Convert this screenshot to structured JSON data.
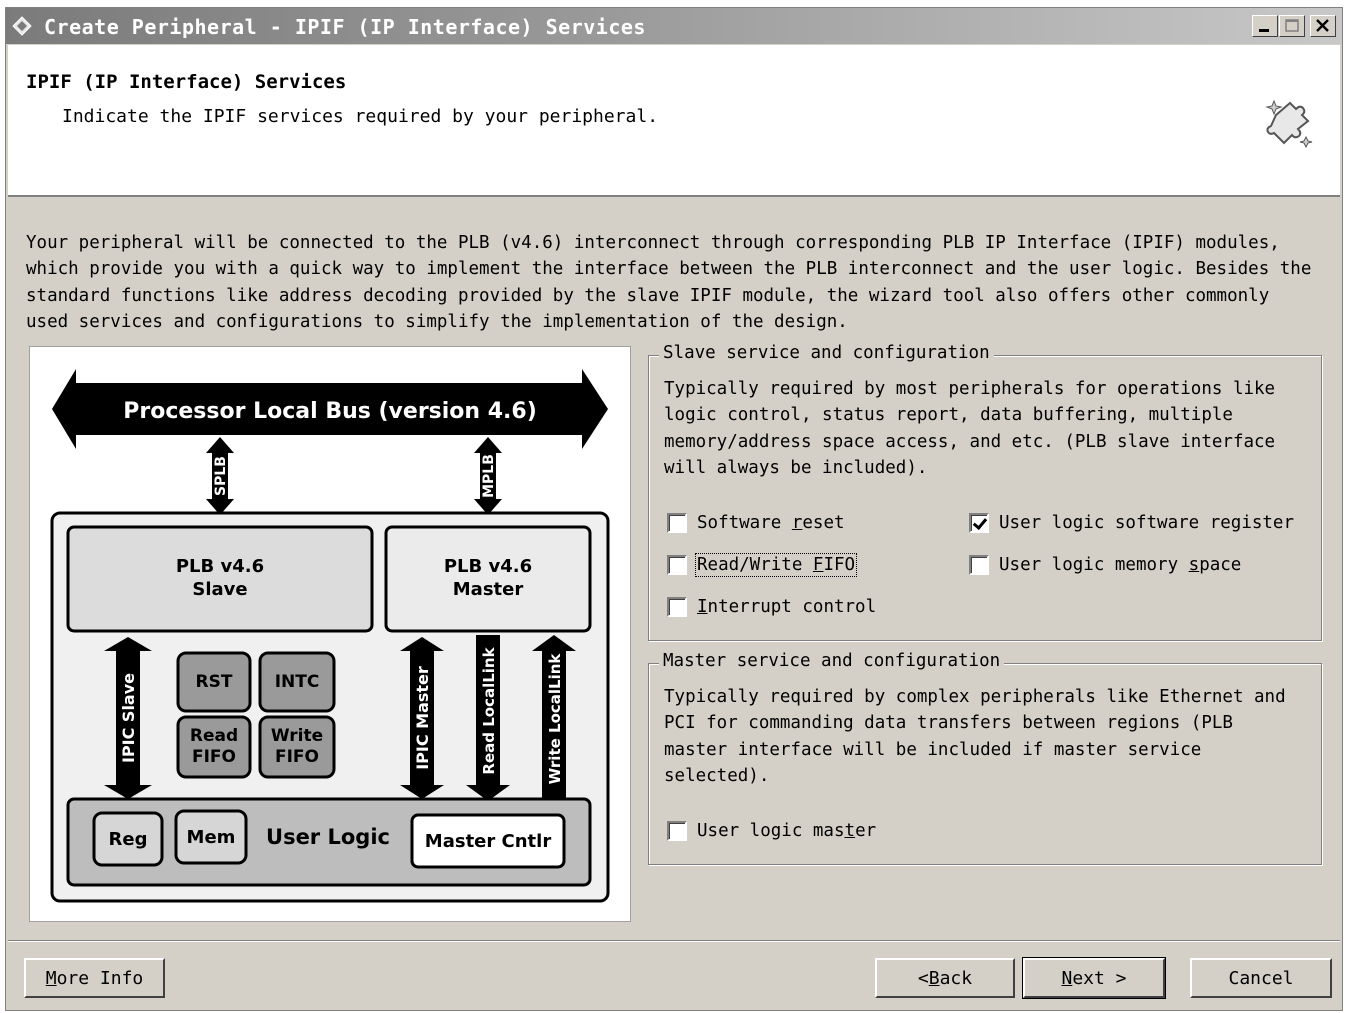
{
  "window": {
    "title": "Create Peripheral - IPIF (IP Interface) Services",
    "controls": [
      "minimize",
      "maximize",
      "close"
    ]
  },
  "header": {
    "title": "IPIF (IP Interface) Services",
    "subtitle": "Indicate the IPIF services required by your peripheral.",
    "icon": "wizard-puzzle-icon"
  },
  "description": "Your peripheral will be connected to the PLB (v4.6) interconnect through corresponding PLB IP Interface (IPIF) modules,\nwhich provide you with a quick way to implement the interface between the PLB interconnect and the user logic. Besides the\nstandard functions like address decoding provided by the slave IPIF module, the wizard tool also offers other commonly\nused services and configurations to simplify the implementation of the design.",
  "diagram": {
    "bus_label": "Processor Local Bus (version 4.6)",
    "splb": "SPLB",
    "mplb": "MPLB",
    "slave_line1": "PLB v4.6",
    "slave_line2": "Slave",
    "master_line1": "PLB v4.6",
    "master_line2": "Master",
    "rst": "RST",
    "intc": "INTC",
    "read_fifo_1": "Read",
    "read_fifo_2": "FIFO",
    "write_fifo_1": "Write",
    "write_fifo_2": "FIFO",
    "ipic_slave": "IPIC Slave",
    "ipic_master": "IPIC Master",
    "read_locallink": "Read LocalLink",
    "write_locallink": "Write LocalLink",
    "reg": "Reg",
    "mem": "Mem",
    "user_logic": "User Logic",
    "master_cntlr": "Master Cntlr"
  },
  "slave_group": {
    "title": "Slave service and configuration",
    "description": "Typically required by most peripherals for operations like\nlogic control, status report, data buffering, multiple\nmemory/address space access, and etc. (PLB slave interface\nwill always be included).",
    "options": {
      "software_reset": {
        "pre": "Software ",
        "u": "r",
        "post": "eset",
        "checked": false
      },
      "read_write_fifo": {
        "pre": "Read/Write ",
        "u": "F",
        "post": "IFO",
        "checked": false
      },
      "interrupt_control": {
        "pre": "",
        "u": "I",
        "post": "nterrupt control",
        "checked": false
      },
      "user_logic_sw_register": {
        "pre": "User logic software register",
        "u": "",
        "post": "",
        "checked": true
      },
      "user_logic_memory_space": {
        "pre": "User logic memory ",
        "u": "s",
        "post": "pace",
        "checked": false
      }
    }
  },
  "master_group": {
    "title": "Master service and configuration",
    "description": "Typically required by complex peripherals like Ethernet and\nPCI for commanding data transfers between regions (PLB\nmaster interface will be included if master service\nselected).",
    "options": {
      "user_logic_master": {
        "pre": "User logic mas",
        "u": "t",
        "post": "er",
        "checked": false
      }
    }
  },
  "buttons": {
    "more_info": {
      "pre": "",
      "u": "M",
      "post": "ore Info"
    },
    "back": {
      "pre": "< ",
      "u": "B",
      "post": "ack"
    },
    "next": {
      "pre": "",
      "u": "N",
      "post": "ext >"
    },
    "cancel": {
      "pre": "Cancel",
      "u": "",
      "post": ""
    }
  }
}
